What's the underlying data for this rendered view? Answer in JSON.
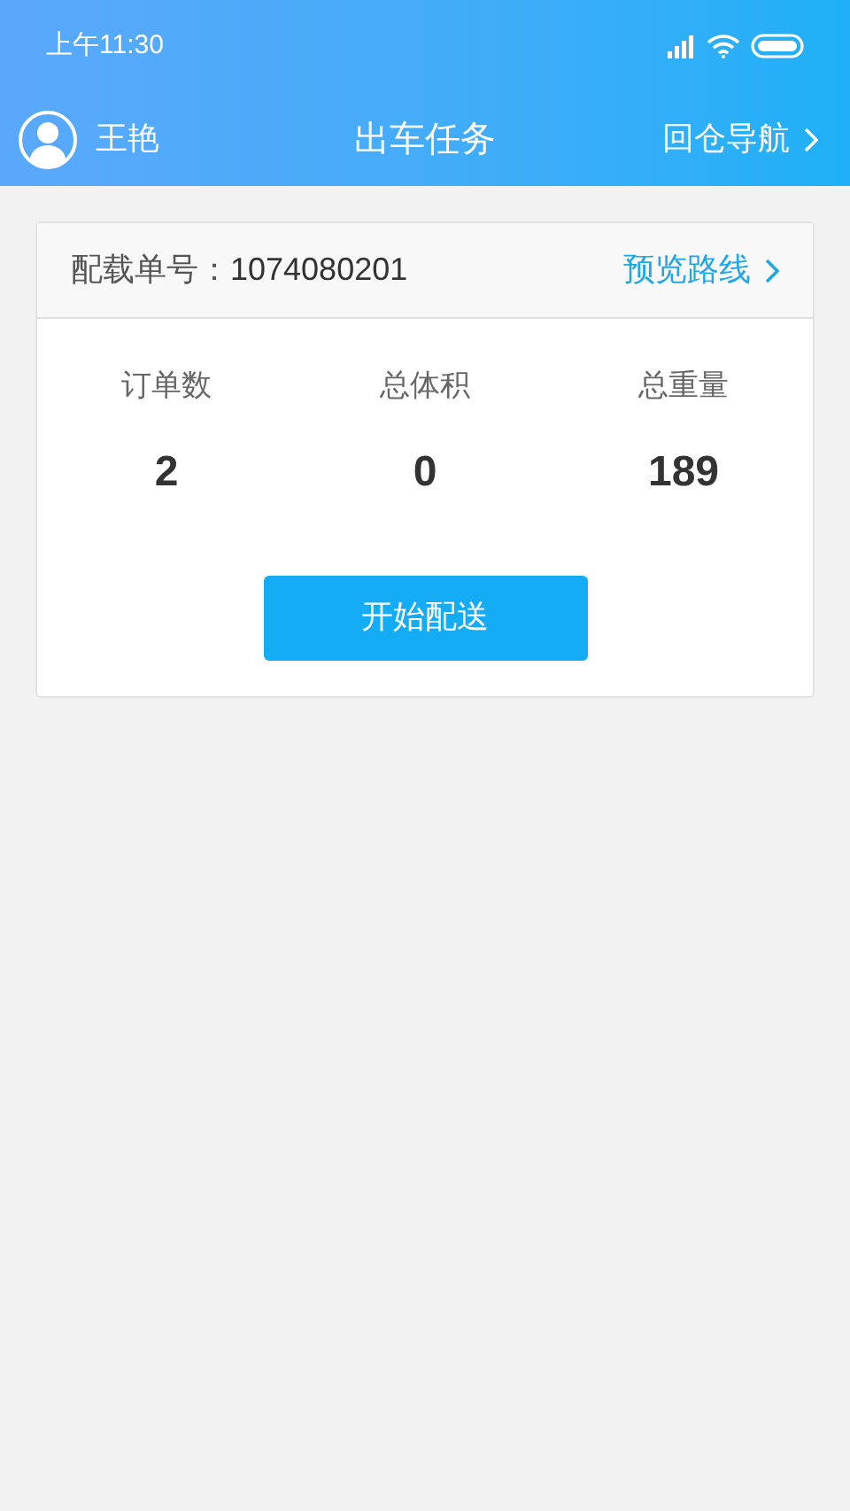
{
  "status_bar": {
    "time": "上午11:30"
  },
  "header": {
    "user_name": "王艳",
    "title": "出车任务",
    "action": "回仓导航"
  },
  "task_card": {
    "label": "配载单号：",
    "number": "1074080201",
    "link": "预览路线",
    "stats": [
      {
        "label": "订单数",
        "value": "2"
      },
      {
        "label": "总体积",
        "value": "0"
      },
      {
        "label": "总重量",
        "value": "189"
      }
    ],
    "button": "开始配送"
  }
}
